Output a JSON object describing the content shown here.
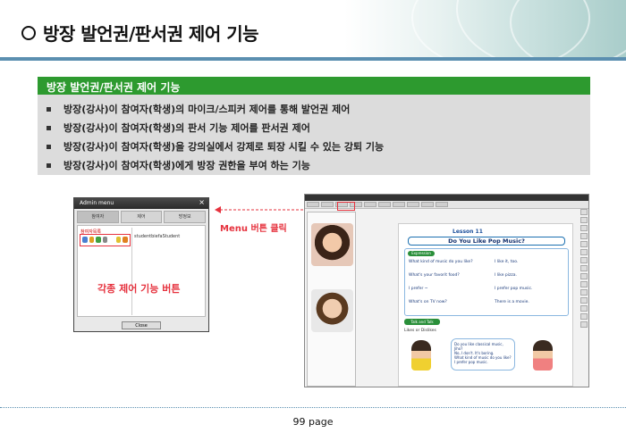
{
  "title": "방장 발언권/판서권 제어 기능",
  "panel": {
    "heading": "방장 발언권/판서권 제어 기능",
    "bullets": [
      "방장(강사)이 참여자(학생)의 마이크/스피커 제어를 통해 발언권 제어",
      "방장(강사)이 참여자(학생)의 판서 기능 제어를 판서권 제어",
      "방장(강사)이 참여자(학생)을 강의실에서 강제로 퇴장 시킬 수 있는 강퇴 기능",
      "방장(강사)이 참여자(학생)에게 방장 권한을 부여 하는 기능"
    ]
  },
  "admin_window": {
    "title": "Admin menu",
    "close_glyph": "×",
    "tabs": [
      "참여자",
      "제어",
      "방정보"
    ],
    "list_label": "참여자목록",
    "user": "studentbiefaStudent",
    "close_button": "Close",
    "caption": "각종 제어 기능 버튼"
  },
  "callout": "Menu 버튼 클릭",
  "lesson": {
    "tag": "Lesson 11",
    "title": "Do You Like Pop Music?",
    "expression_tag": "Expression",
    "rows_left": [
      "What kind of music do you like?",
      "What's your favorit food?",
      "I prefer ~",
      "What's on TV now?"
    ],
    "rows_right": [
      "I like it, too.",
      "I like pizza.",
      "I prefer pop music.",
      "There is a movie."
    ],
    "talk_tag": "Talk and Talk",
    "likes": "Likes or Dislikes",
    "bubble_lines": [
      "Do you like classical music, Jiho?",
      "No, I don't. It's boring.",
      "What kind of music do you like?",
      "I prefer pop music."
    ]
  },
  "page": "99 page",
  "colors": {
    "accent_green": "#2d9a2f",
    "accent_red": "#e6323e",
    "header_blue": "#5b8fb0"
  }
}
